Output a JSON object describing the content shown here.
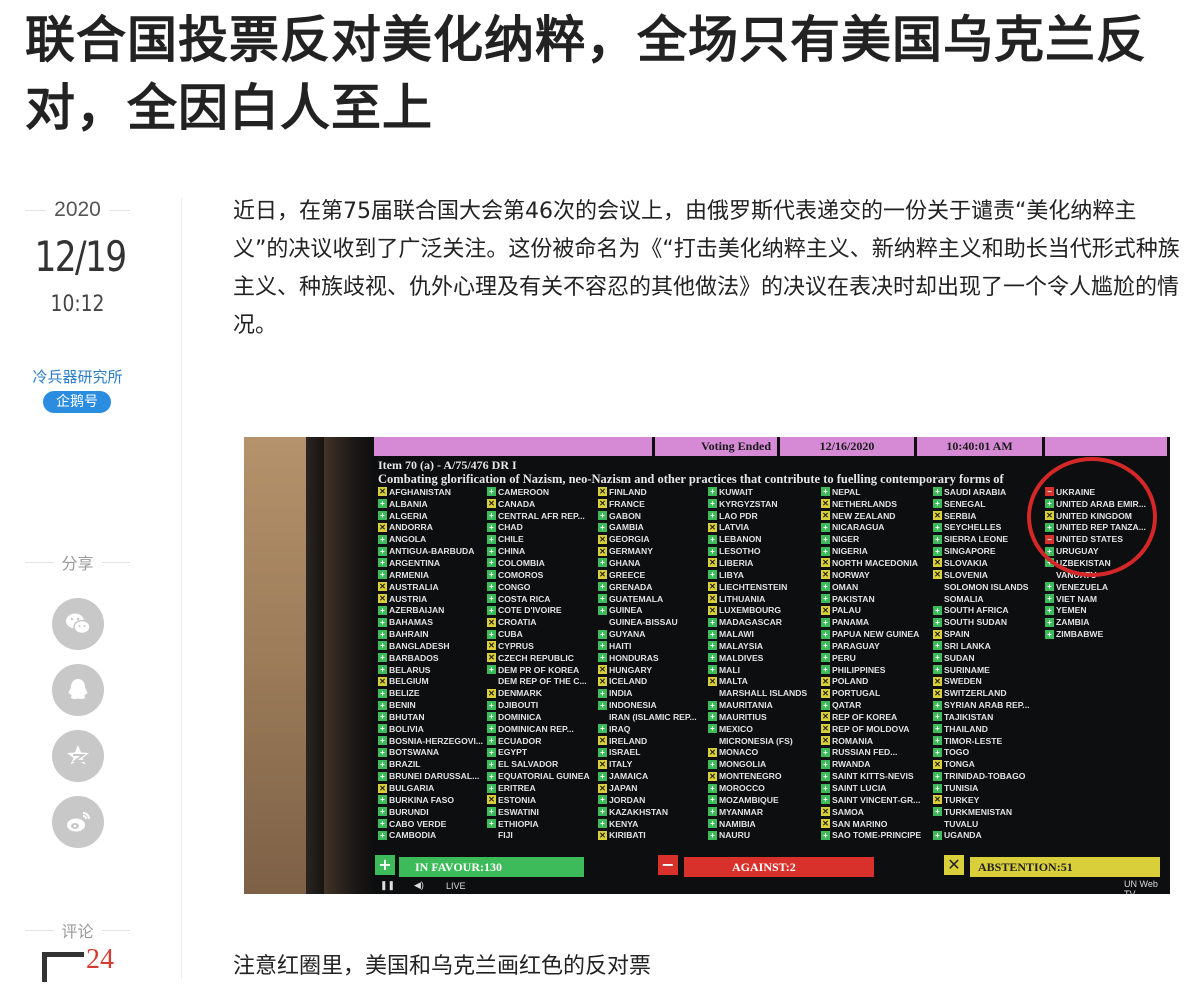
{
  "article": {
    "title": "联合国投票反对美化纳粹，全场只有美国乌克兰反对，全因白人至上",
    "paragraph": "近日，在第75届联合国大会第46次的会议上，由俄罗斯代表递交的一份关于谴责“美化纳粹主义”的决议收到了广泛关注。这份被命名为《“打击美化纳粹主义、新纳粹主义和助长当代形式种族主义、种族歧视、仇外心理及有关不容忍的其他做法》的决议在表决时却出现了一个令人尴尬的情况。",
    "caption": "注意红圈里，美国和乌克兰画红色的反对票"
  },
  "sidebar": {
    "year": "2020",
    "month_day": "12/19",
    "time": "10:12",
    "author": "冷兵器研究所",
    "badge": "企鹅号",
    "share_label": "分享",
    "share_buttons": [
      "wechat-icon",
      "qq-icon",
      "qzone-icon",
      "weibo-icon"
    ],
    "comment_label": "评论",
    "comment_count": "24"
  },
  "vote_board": {
    "status": "Voting Ended",
    "date": "12/16/2020",
    "time": "10:40:01 AM",
    "item": "Item 70 (a) - A/75/476 DR I",
    "subject": "Combating glorification of Nazism, neo-Nazism and other practices that contribute to fuelling contemporary forms of",
    "columns": [
      [
        [
          "a",
          "AFGHANISTAN"
        ],
        [
          "y",
          "ALBANIA"
        ],
        [
          "y",
          "ALGERIA"
        ],
        [
          "a",
          "ANDORRA"
        ],
        [
          "y",
          "ANGOLA"
        ],
        [
          "y",
          "ANTIGUA-BARBUDA"
        ],
        [
          "y",
          "ARGENTINA"
        ],
        [
          "y",
          "ARMENIA"
        ],
        [
          "a",
          "AUSTRALIA"
        ],
        [
          "a",
          "AUSTRIA"
        ],
        [
          "y",
          "AZERBAIJAN"
        ],
        [
          "y",
          "BAHAMAS"
        ],
        [
          "y",
          "BAHRAIN"
        ],
        [
          "y",
          "BANGLADESH"
        ],
        [
          "y",
          "BARBADOS"
        ],
        [
          "y",
          "BELARUS"
        ],
        [
          "a",
          "BELGIUM"
        ],
        [
          "y",
          "BELIZE"
        ],
        [
          "y",
          "BENIN"
        ],
        [
          "y",
          "BHUTAN"
        ],
        [
          "y",
          "BOLIVIA"
        ],
        [
          "y",
          "BOSNIA-HERZEGOVI..."
        ],
        [
          "y",
          "BOTSWANA"
        ],
        [
          "y",
          "BRAZIL"
        ],
        [
          "y",
          "BRUNEI DARUSSAL..."
        ],
        [
          "a",
          "BULGARIA"
        ],
        [
          "y",
          "BURKINA FASO"
        ],
        [
          "y",
          "BURUNDI"
        ],
        [
          "y",
          "CABO VERDE"
        ],
        [
          "y",
          "CAMBODIA"
        ]
      ],
      [
        [
          "y",
          "CAMEROON"
        ],
        [
          "a",
          "CANADA"
        ],
        [
          "y",
          "CENTRAL AFR REP..."
        ],
        [
          "y",
          "CHAD"
        ],
        [
          "y",
          "CHILE"
        ],
        [
          "y",
          "CHINA"
        ],
        [
          "y",
          "COLOMBIA"
        ],
        [
          "y",
          "COMOROS"
        ],
        [
          "y",
          "CONGO"
        ],
        [
          "y",
          "COSTA RICA"
        ],
        [
          "y",
          "COTE D'IVOIRE"
        ],
        [
          "a",
          "CROATIA"
        ],
        [
          "y",
          "CUBA"
        ],
        [
          "a",
          "CYPRUS"
        ],
        [
          "a",
          "CZECH REPUBLIC"
        ],
        [
          "y",
          "DEM PR OF KOREA"
        ],
        [
          "b",
          "DEM REP OF THE C..."
        ],
        [
          "a",
          "DENMARK"
        ],
        [
          "y",
          "DJIBOUTI"
        ],
        [
          "y",
          "DOMINICA"
        ],
        [
          "y",
          "DOMINICAN REP..."
        ],
        [
          "y",
          "ECUADOR"
        ],
        [
          "y",
          "EGYPT"
        ],
        [
          "y",
          "EL SALVADOR"
        ],
        [
          "y",
          "EQUATORIAL GUINEA"
        ],
        [
          "y",
          "ERITREA"
        ],
        [
          "a",
          "ESTONIA"
        ],
        [
          "y",
          "ESWATINI"
        ],
        [
          "y",
          "ETHIOPIA"
        ],
        [
          "b",
          "FIJI"
        ]
      ],
      [
        [
          "a",
          "FINLAND"
        ],
        [
          "a",
          "FRANCE"
        ],
        [
          "y",
          "GABON"
        ],
        [
          "y",
          "GAMBIA"
        ],
        [
          "a",
          "GEORGIA"
        ],
        [
          "a",
          "GERMANY"
        ],
        [
          "y",
          "GHANA"
        ],
        [
          "a",
          "GREECE"
        ],
        [
          "y",
          "GRENADA"
        ],
        [
          "y",
          "GUATEMALA"
        ],
        [
          "y",
          "GUINEA"
        ],
        [
          "b",
          "GUINEA-BISSAU"
        ],
        [
          "y",
          "GUYANA"
        ],
        [
          "y",
          "HAITI"
        ],
        [
          "y",
          "HONDURAS"
        ],
        [
          "a",
          "HUNGARY"
        ],
        [
          "a",
          "ICELAND"
        ],
        [
          "y",
          "INDIA"
        ],
        [
          "y",
          "INDONESIA"
        ],
        [
          "b",
          "IRAN (ISLAMIC REP..."
        ],
        [
          "y",
          "IRAQ"
        ],
        [
          "a",
          "IRELAND"
        ],
        [
          "y",
          "ISRAEL"
        ],
        [
          "a",
          "ITALY"
        ],
        [
          "y",
          "JAMAICA"
        ],
        [
          "a",
          "JAPAN"
        ],
        [
          "y",
          "JORDAN"
        ],
        [
          "y",
          "KAZAKHSTAN"
        ],
        [
          "y",
          "KENYA"
        ],
        [
          "a",
          "KIRIBATI"
        ]
      ],
      [
        [
          "y",
          "KUWAIT"
        ],
        [
          "y",
          "KYRGYZSTAN"
        ],
        [
          "y",
          "LAO PDR"
        ],
        [
          "a",
          "LATVIA"
        ],
        [
          "y",
          "LEBANON"
        ],
        [
          "y",
          "LESOTHO"
        ],
        [
          "a",
          "LIBERIA"
        ],
        [
          "y",
          "LIBYA"
        ],
        [
          "a",
          "LIECHTENSTEIN"
        ],
        [
          "a",
          "LITHUANIA"
        ],
        [
          "a",
          "LUXEMBOURG"
        ],
        [
          "y",
          "MADAGASCAR"
        ],
        [
          "y",
          "MALAWI"
        ],
        [
          "y",
          "MALAYSIA"
        ],
        [
          "y",
          "MALDIVES"
        ],
        [
          "y",
          "MALI"
        ],
        [
          "a",
          "MALTA"
        ],
        [
          "b",
          "MARSHALL ISLANDS"
        ],
        [
          "y",
          "MAURITANIA"
        ],
        [
          "y",
          "MAURITIUS"
        ],
        [
          "y",
          "MEXICO"
        ],
        [
          "b",
          "MICRONESIA (FS)"
        ],
        [
          "a",
          "MONACO"
        ],
        [
          "y",
          "MONGOLIA"
        ],
        [
          "a",
          "MONTENEGRO"
        ],
        [
          "y",
          "MOROCCO"
        ],
        [
          "y",
          "MOZAMBIQUE"
        ],
        [
          "y",
          "MYANMAR"
        ],
        [
          "y",
          "NAMIBIA"
        ],
        [
          "y",
          "NAURU"
        ]
      ],
      [
        [
          "y",
          "NEPAL"
        ],
        [
          "a",
          "NETHERLANDS"
        ],
        [
          "a",
          "NEW ZEALAND"
        ],
        [
          "y",
          "NICARAGUA"
        ],
        [
          "y",
          "NIGER"
        ],
        [
          "y",
          "NIGERIA"
        ],
        [
          "a",
          "NORTH MACEDONIA"
        ],
        [
          "a",
          "NORWAY"
        ],
        [
          "y",
          "OMAN"
        ],
        [
          "y",
          "PAKISTAN"
        ],
        [
          "a",
          "PALAU"
        ],
        [
          "y",
          "PANAMA"
        ],
        [
          "y",
          "PAPUA NEW GUINEA"
        ],
        [
          "y",
          "PARAGUAY"
        ],
        [
          "y",
          "PERU"
        ],
        [
          "y",
          "PHILIPPINES"
        ],
        [
          "a",
          "POLAND"
        ],
        [
          "a",
          "PORTUGAL"
        ],
        [
          "y",
          "QATAR"
        ],
        [
          "a",
          "REP OF KOREA"
        ],
        [
          "a",
          "REP OF MOLDOVA"
        ],
        [
          "a",
          "ROMANIA"
        ],
        [
          "y",
          "RUSSIAN FED..."
        ],
        [
          "y",
          "RWANDA"
        ],
        [
          "y",
          "SAINT KITTS-NEVIS"
        ],
        [
          "y",
          "SAINT LUCIA"
        ],
        [
          "y",
          "SAINT VINCENT-GR..."
        ],
        [
          "a",
          "SAMOA"
        ],
        [
          "a",
          "SAN MARINO"
        ],
        [
          "y",
          "SAO TOME-PRINCIPE"
        ]
      ],
      [
        [
          "y",
          "SAUDI ARABIA"
        ],
        [
          "y",
          "SENEGAL"
        ],
        [
          "a",
          "SERBIA"
        ],
        [
          "y",
          "SEYCHELLES"
        ],
        [
          "y",
          "SIERRA LEONE"
        ],
        [
          "y",
          "SINGAPORE"
        ],
        [
          "a",
          "SLOVAKIA"
        ],
        [
          "a",
          "SLOVENIA"
        ],
        [
          "b",
          "SOLOMON ISLANDS"
        ],
        [
          "b",
          "SOMALIA"
        ],
        [
          "y",
          "SOUTH AFRICA"
        ],
        [
          "y",
          "SOUTH SUDAN"
        ],
        [
          "a",
          "SPAIN"
        ],
        [
          "y",
          "SRI LANKA"
        ],
        [
          "y",
          "SUDAN"
        ],
        [
          "y",
          "SURINAME"
        ],
        [
          "a",
          "SWEDEN"
        ],
        [
          "a",
          "SWITZERLAND"
        ],
        [
          "y",
          "SYRIAN ARAB REP..."
        ],
        [
          "y",
          "TAJIKISTAN"
        ],
        [
          "y",
          "THAILAND"
        ],
        [
          "y",
          "TIMOR-LESTE"
        ],
        [
          "y",
          "TOGO"
        ],
        [
          "a",
          "TONGA"
        ],
        [
          "y",
          "TRINIDAD-TOBAGO"
        ],
        [
          "y",
          "TUNISIA"
        ],
        [
          "a",
          "TURKEY"
        ],
        [
          "y",
          "TURKMENISTAN"
        ],
        [
          "b",
          "TUVALU"
        ],
        [
          "y",
          "UGANDA"
        ]
      ],
      [
        [
          "n",
          "UKRAINE"
        ],
        [
          "y",
          "UNITED ARAB EMIR..."
        ],
        [
          "a",
          "UNITED KINGDOM"
        ],
        [
          "y",
          "UNITED REP TANZA..."
        ],
        [
          "n",
          "UNITED STATES"
        ],
        [
          "y",
          "URUGUAY"
        ],
        [
          "y",
          "UZBEKISTAN"
        ],
        [
          "b",
          "VANUATU"
        ],
        [
          "y",
          "VENEZUELA"
        ],
        [
          "y",
          "VIET NAM"
        ],
        [
          "y",
          "YEMEN"
        ],
        [
          "y",
          "ZAMBIA"
        ],
        [
          "y",
          "ZIMBABWE"
        ]
      ]
    ],
    "in_favour": "IN FAVOUR:130",
    "against": "AGAINST:2",
    "abstention": "ABSTENTION:51",
    "live_label": "LIVE",
    "watermark": "UN Web TV",
    "colors": {
      "favour": "#3dbb5a",
      "against": "#d8312b",
      "abstention": "#d9cf3b",
      "header": "#d68ad6",
      "circle": "#d42828"
    }
  }
}
